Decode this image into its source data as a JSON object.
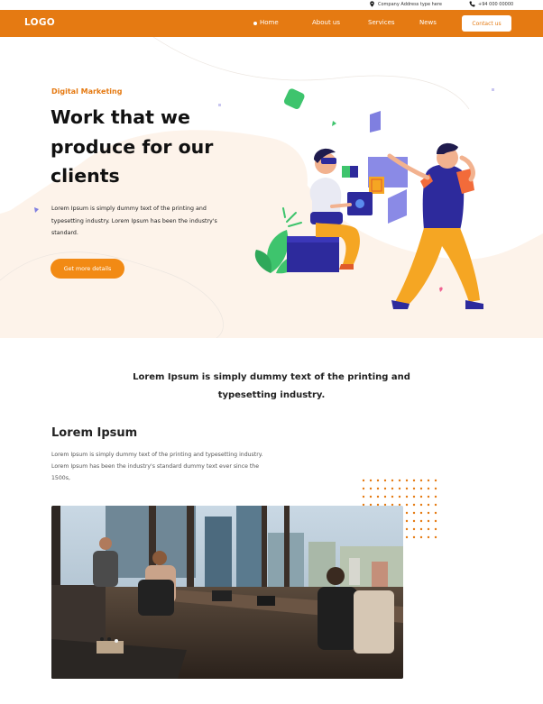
{
  "topbar": {
    "address_icon": "map-pin-icon",
    "address": "Company Address type here",
    "phone_icon": "phone-icon",
    "phone": "+94 000 00000"
  },
  "nav": {
    "logo": "LOGO",
    "links": [
      "Home",
      "About us",
      "Services",
      "News"
    ],
    "active_link": "Home",
    "contact_label": "Contact us"
  },
  "hero": {
    "eyebrow": "Digital Marketing",
    "title": "Work that we produce for our clients",
    "description": "Lorem Ipsum is simply dummy text of the printing and typesetting industry. Lorem Ipsum has been the industry's standard.",
    "cta_label": "Get more details"
  },
  "intro": {
    "tagline": "Lorem Ipsum is simply dummy text of the printing and typesetting industry."
  },
  "section": {
    "heading": "Lorem Ipsum",
    "paragraph": "Lorem Ipsum is simply dummy text of the printing and typesetting industry. Lorem Ipsum has been the industry's standard dummy text ever since the 1500s,"
  },
  "colors": {
    "accent": "#e57a12",
    "button": "#f28a14",
    "hero_bg": "#fdf3ea",
    "illustration_blue": "#2d2a9c",
    "illustration_yellow": "#f5a623",
    "illustration_purple": "#7f7fe0",
    "illustration_green": "#3ec46d"
  }
}
